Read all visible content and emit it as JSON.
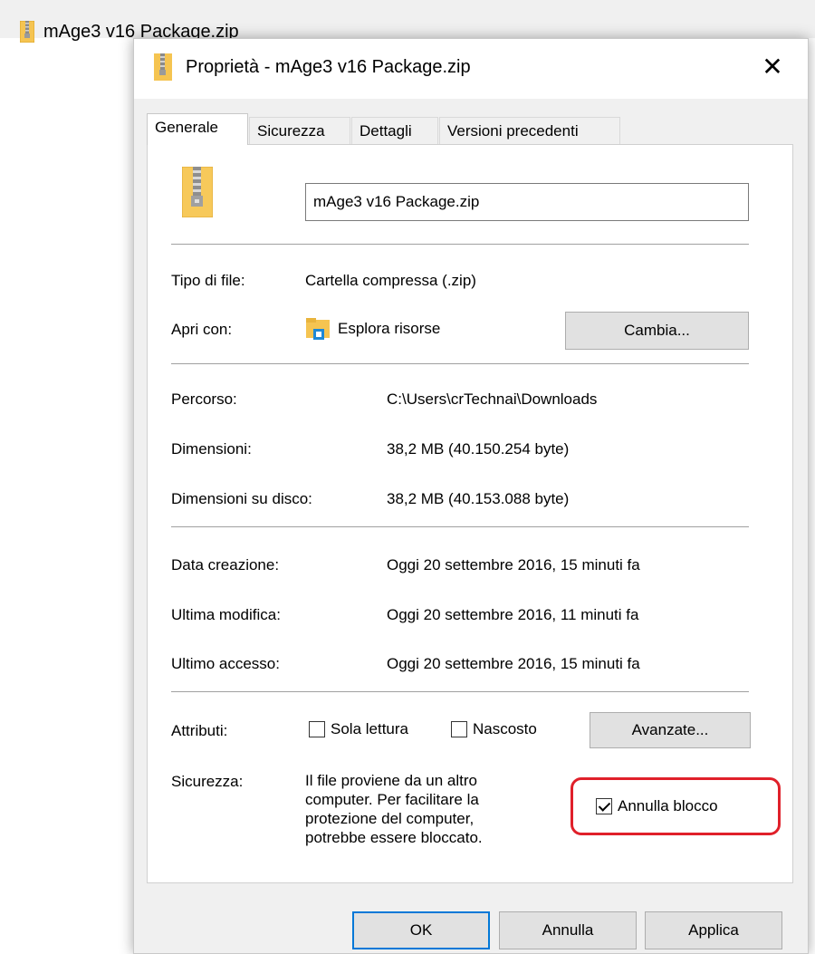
{
  "background": {
    "file_name": "mAge3 v16 Package.zip",
    "file_icon": "zip-folder-icon"
  },
  "dialog": {
    "title": "Proprietà - mAge3 v16 Package.zip",
    "title_icon": "zip-folder-icon",
    "close_label": "✕",
    "tabs": [
      {
        "label": "Generale",
        "active": true
      },
      {
        "label": "Sicurezza",
        "active": false
      },
      {
        "label": "Dettagli",
        "active": false
      },
      {
        "label": "Versioni precedenti",
        "active": false
      }
    ],
    "file_icon": "zip-folder-large-icon",
    "name_value": "mAge3 v16 Package.zip",
    "file_type": {
      "label": "Tipo di file:",
      "value": "Cartella compressa (.zip)"
    },
    "open_with": {
      "label": "Apri con:",
      "value": "Esplora risorse",
      "icon": "file-explorer-icon",
      "button": "Cambia..."
    },
    "location": {
      "label": "Percorso:",
      "value": "C:\\Users\\crTechnai\\Downloads"
    },
    "size": {
      "label": "Dimensioni:",
      "value": "38,2 MB (40.150.254 byte)"
    },
    "size_on_disk": {
      "label": "Dimensioni su disco:",
      "value": "38,2 MB (40.153.088 byte)"
    },
    "created": {
      "label": "Data creazione:",
      "value": "Oggi 20 settembre 2016, 15 minuti fa"
    },
    "modified": {
      "label": "Ultima modifica:",
      "value": "Oggi 20 settembre 2016, 11 minuti fa"
    },
    "accessed": {
      "label": "Ultimo accesso:",
      "value": "Oggi 20 settembre 2016, 15 minuti fa"
    },
    "attributes": {
      "label": "Attributi:",
      "read_only": {
        "label": "Sola lettura",
        "checked": false
      },
      "hidden": {
        "label": "Nascosto",
        "checked": false
      },
      "advanced_button": "Avanzate..."
    },
    "security": {
      "label": "Sicurezza:",
      "message_lines": [
        "Il file proviene da un altro",
        "computer. Per facilitare la",
        "protezione del computer,",
        "potrebbe essere bloccato."
      ],
      "unblock": {
        "label": "Annulla blocco",
        "checked": true
      },
      "highlight_color": "#e0202a"
    },
    "buttons": {
      "ok": "OK",
      "cancel": "Annulla",
      "apply": "Applica"
    }
  }
}
